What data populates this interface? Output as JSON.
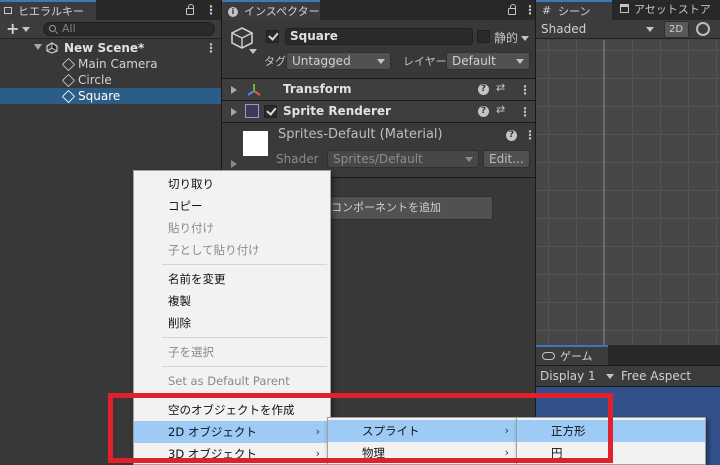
{
  "hierarchy": {
    "tab_label": "ヒエラルキー",
    "add_label": "+",
    "search_placeholder": "All",
    "scene_name": "New Scene*",
    "items": [
      "Main Camera",
      "Circle",
      "Square"
    ]
  },
  "inspector": {
    "tab_label": "インスペクター",
    "object_name": "Square",
    "static_label": "静的",
    "tag_label": "タグ",
    "tag_value": "Untagged",
    "layer_label": "レイヤー",
    "layer_value": "Default",
    "components": [
      "Transform",
      "Sprite Renderer"
    ],
    "material_name": "Sprites-Default (Material)",
    "shader_label": "Shader",
    "shader_value": "Sprites/Default",
    "edit_label": "Edit...",
    "add_component_label": "コンポーネントを追加"
  },
  "scene": {
    "tab_label": "シーン",
    "asset_store_label": "アセットストア",
    "shading_mode": "Shaded",
    "mode_2d": "2D"
  },
  "game": {
    "tab_label": "ゲーム",
    "display": "Display 1",
    "aspect": "Free Aspect"
  },
  "context_menu": {
    "items": [
      "切り取り",
      "コピー",
      "貼り付け",
      "子として貼り付け",
      "名前を変更",
      "複製",
      "削除",
      "子を選択",
      "Set as Default Parent",
      "空のオブジェクトを作成",
      "2D オブジェクト",
      "3D オブジェクト"
    ]
  },
  "submenu_2d": {
    "items": [
      "スプライト",
      "物理"
    ]
  },
  "submenu_sprite": {
    "items": [
      "正方形",
      "円"
    ]
  },
  "colors": {
    "accent": "#3a79bb",
    "selection": "#2c5d87",
    "highlight": "#9dcbf5",
    "annotation": "#e0202a"
  }
}
